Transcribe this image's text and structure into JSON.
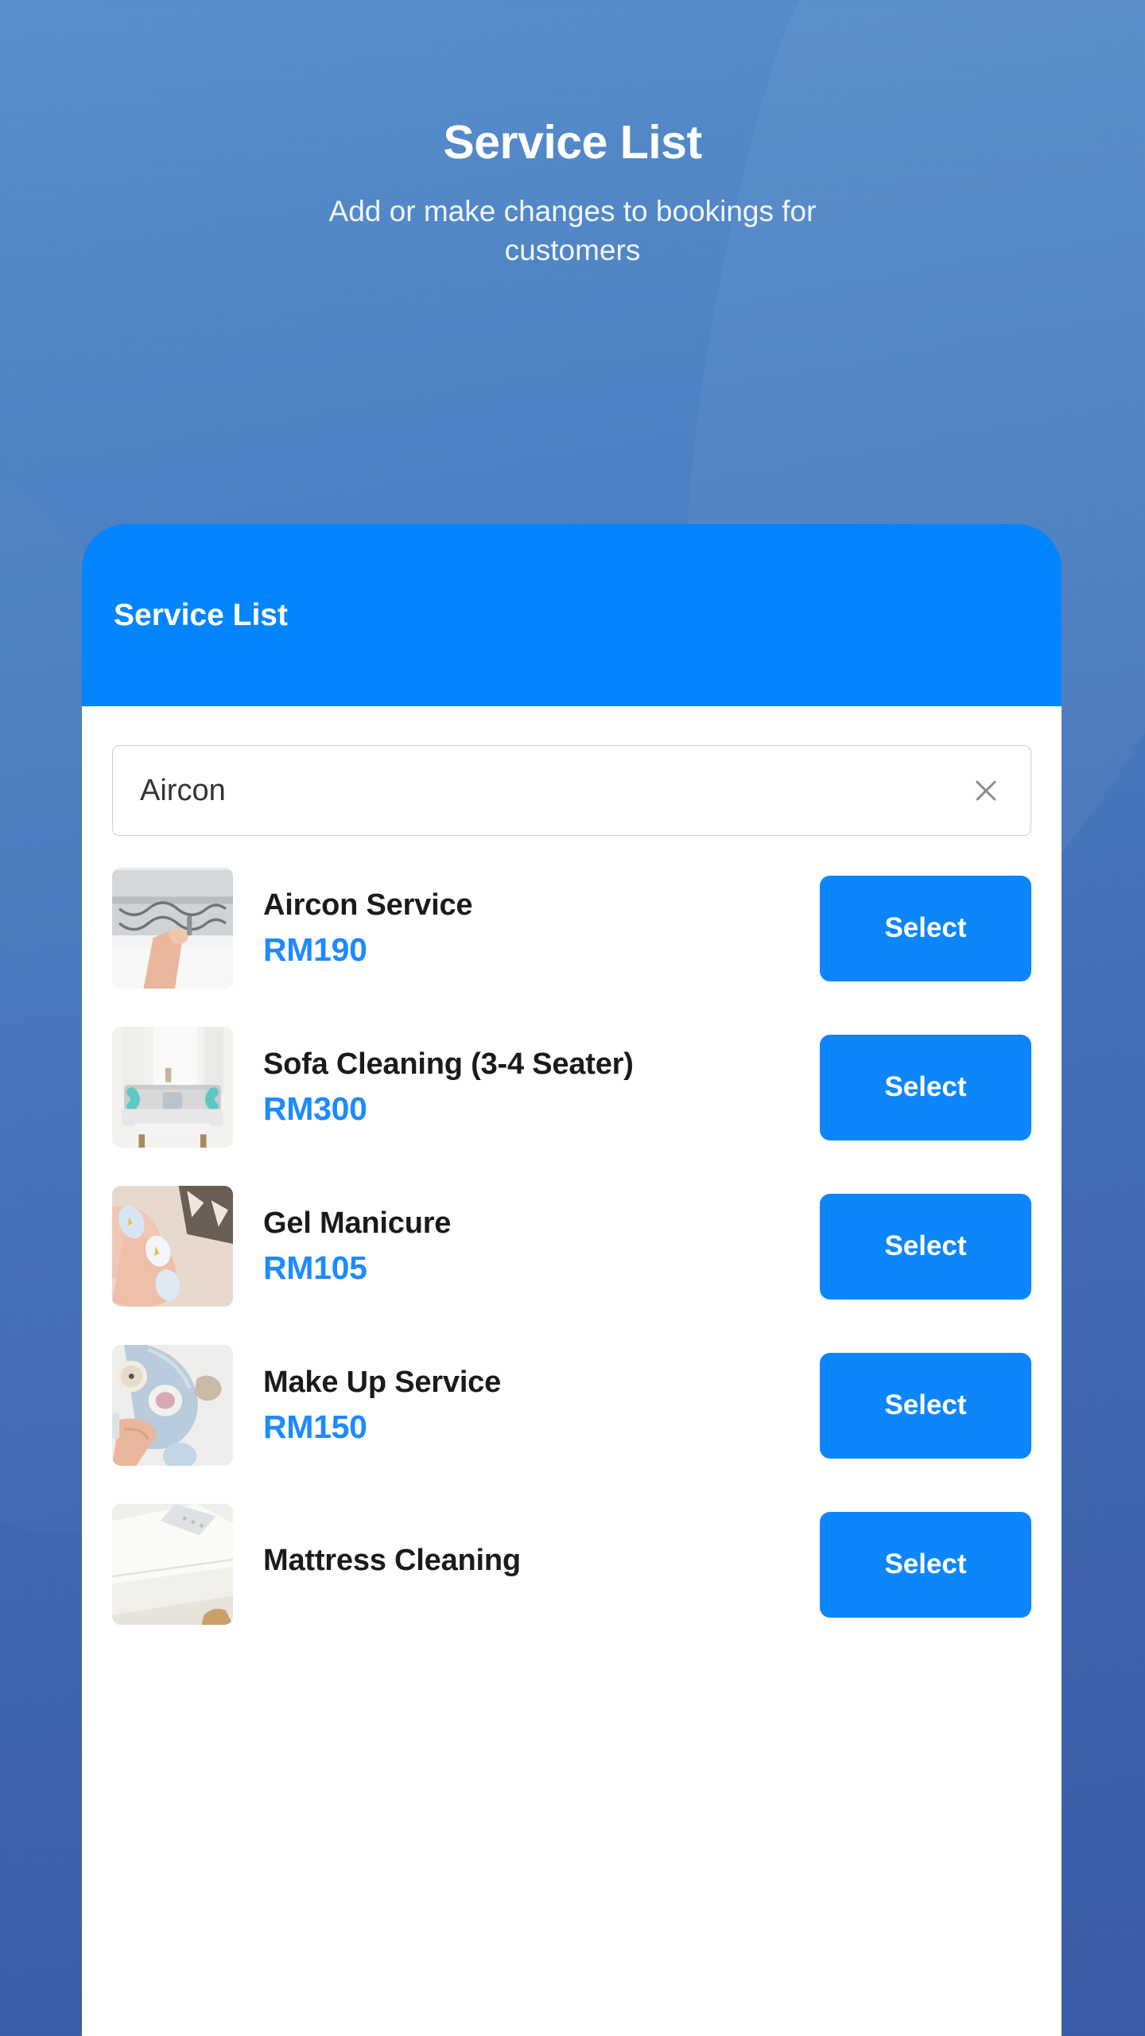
{
  "header": {
    "title": "Service List",
    "subtitle": "Add or make changes to bookings for customers"
  },
  "card": {
    "header_title": "Service List"
  },
  "search": {
    "value": "Aircon",
    "placeholder": "Search",
    "clear_icon": "close-icon"
  },
  "colors": {
    "accent": "#0285ff",
    "button": "#0d86fb",
    "price": "#1e8aff",
    "bg_top": "#5288c8",
    "bg_bottom": "#3b5aa5",
    "card_bg": "#ffffff",
    "title_text": "#1b1b1b"
  },
  "services": [
    {
      "name": "Aircon Service",
      "price": "RM190",
      "thumb": "aircon-service-thumbnail",
      "action": "Select"
    },
    {
      "name": "Sofa Cleaning (3-4 Seater)",
      "price": "RM300",
      "thumb": "sofa-cleaning-thumbnail",
      "action": "Select"
    },
    {
      "name": "Gel Manicure",
      "price": "RM105",
      "thumb": "gel-manicure-thumbnail",
      "action": "Select"
    },
    {
      "name": "Make Up Service",
      "price": "RM150",
      "thumb": "make-up-service-thumbnail",
      "action": "Select"
    },
    {
      "name": "Mattress Cleaning",
      "price": "",
      "thumb": "mattress-cleaning-thumbnail",
      "action": "Select"
    }
  ]
}
